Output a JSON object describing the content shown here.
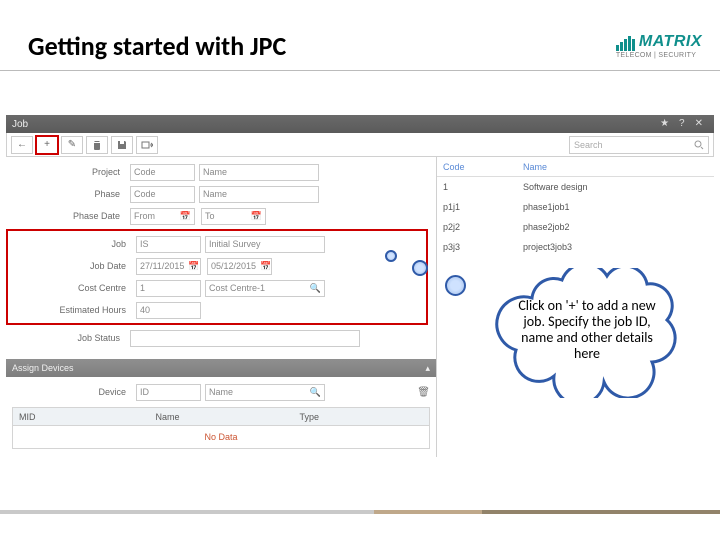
{
  "slide": {
    "title": "Getting started with JPC"
  },
  "logo": {
    "name": "MATRIX",
    "tagline": "TELECOM | SECURITY"
  },
  "window": {
    "title": "Job",
    "search_placeholder": "Search"
  },
  "toolbar": {
    "back": "←",
    "add": "+",
    "edit": "✎",
    "delete": "🗑",
    "save": "💾",
    "import": "📥"
  },
  "form": {
    "labels": {
      "project": "Project",
      "phase": "Phase",
      "phase_date": "Phase Date",
      "job": "Job",
      "job_date": "Job Date",
      "cost_centre": "Cost Centre",
      "est_hours": "Estimated Hours",
      "job_status": "Job Status"
    },
    "project_code": "Code",
    "project_name": "Name",
    "phase_code": "Code",
    "phase_name": "Name",
    "phase_from": "From",
    "phase_to": "To",
    "job_code": "IS",
    "job_name": "Initial Survey",
    "job_from": "27/11/2015",
    "job_to": "05/12/2015",
    "cost_code": "1",
    "cost_name": "Cost Centre-1",
    "est_hours": "40",
    "status": ""
  },
  "devices": {
    "section": "Assign Devices",
    "device_label": "Device",
    "id_ph": "ID",
    "name_ph": "Name",
    "cols": {
      "mid": "MID",
      "name": "Name",
      "type": "Type"
    },
    "empty": "No Data"
  },
  "lookup": {
    "head": {
      "code": "Code",
      "name": "Name"
    },
    "rows": [
      {
        "code": "1",
        "name": "Software design"
      },
      {
        "code": "p1j1",
        "name": "phase1job1"
      },
      {
        "code": "p2j2",
        "name": "phase2job2"
      },
      {
        "code": "p3j3",
        "name": "project3job3"
      }
    ]
  },
  "callout": {
    "text": "Click on '+' to add a new job. Specify the job ID, name and other details here"
  }
}
